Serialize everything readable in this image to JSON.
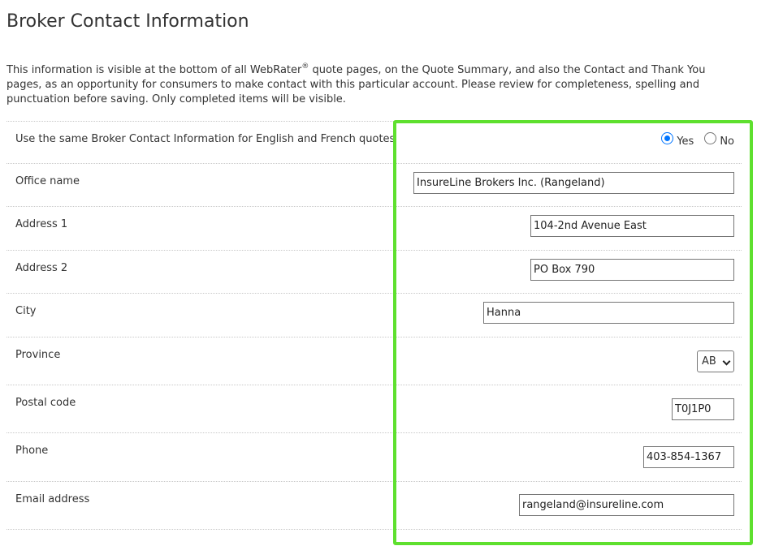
{
  "page": {
    "title": "Broker Contact Information",
    "intro_part1": "This information is visible at the bottom of all WebRater",
    "intro_reg": "®",
    "intro_part2": " quote pages, on the Quote Summary, and also the Contact and Thank You pages, as an opportunity for consumers to make contact with this particular account. Please review for completeness, spelling and punctuation before saving. Only completed items will be visible."
  },
  "form": {
    "same_info": {
      "label": "Use the same Broker Contact Information for English and French quotes",
      "yes_label": "Yes",
      "no_label": "No",
      "selected": "Yes"
    },
    "office_name": {
      "label": "Office name",
      "value": "InsureLine Brokers Inc. (Rangeland)"
    },
    "address1": {
      "label": "Address 1",
      "value": "104-2nd Avenue East"
    },
    "address2": {
      "label": "Address 2",
      "value": "PO Box 790"
    },
    "city": {
      "label": "City",
      "value": "Hanna"
    },
    "province": {
      "label": "Province",
      "value": "AB"
    },
    "postal_code": {
      "label": "Postal code",
      "value": "T0J1P0"
    },
    "phone": {
      "label": "Phone",
      "value": "403-854-1367"
    },
    "email": {
      "label": "Email address",
      "value": "rangeland@insureline.com"
    }
  },
  "colors": {
    "highlight": "#5ee02e",
    "radio_accent": "#0075ff"
  }
}
